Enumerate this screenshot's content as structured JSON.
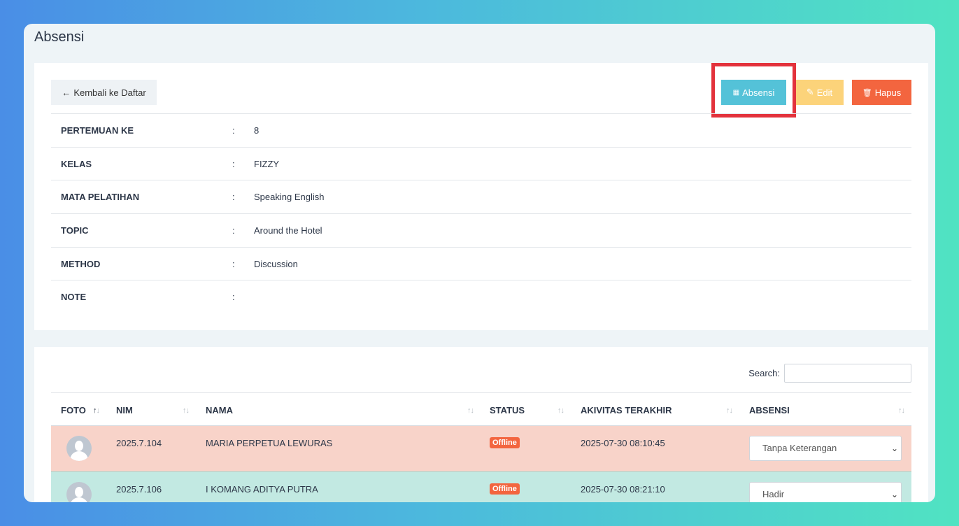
{
  "page": {
    "title": "Absensi"
  },
  "actions": {
    "back_label": "Kembali ke Daftar",
    "absensi_label": "Absensi",
    "edit_label": "Edit",
    "hapus_label": "Hapus"
  },
  "details": [
    {
      "label": "PERTEMUAN KE",
      "value": "8"
    },
    {
      "label": "KELAS",
      "value": "FIZZY"
    },
    {
      "label": "MATA PELATIHAN",
      "value": "Speaking English"
    },
    {
      "label": "TOPIC",
      "value": "Around the Hotel"
    },
    {
      "label": "METHOD",
      "value": "Discussion"
    },
    {
      "label": "NOTE",
      "value": ""
    }
  ],
  "separator": ":",
  "search": {
    "label": "Search:",
    "value": ""
  },
  "table": {
    "headers": [
      "FOTO",
      "NIM",
      "NAMA",
      "STATUS",
      "AKIVITAS TERAKHIR",
      "ABSENSI"
    ],
    "rows": [
      {
        "nim": "2025.7.104",
        "nama": "MARIA PERPETUA LEWURAS",
        "status": "Offline",
        "aktivitas": "2025-07-30 08:10:45",
        "absensi": "Tanpa Keterangan"
      },
      {
        "nim": "2025.7.106",
        "nama": "I KOMANG ADITYA PUTRA",
        "status": "Offline",
        "aktivitas": "2025-07-30 08:21:10",
        "absensi": "Hadir"
      }
    ]
  },
  "colors": {
    "absensi": "#54c2d8",
    "edit": "#fcd37a",
    "hapus": "#f3653f",
    "highlight": "#e3323c"
  }
}
